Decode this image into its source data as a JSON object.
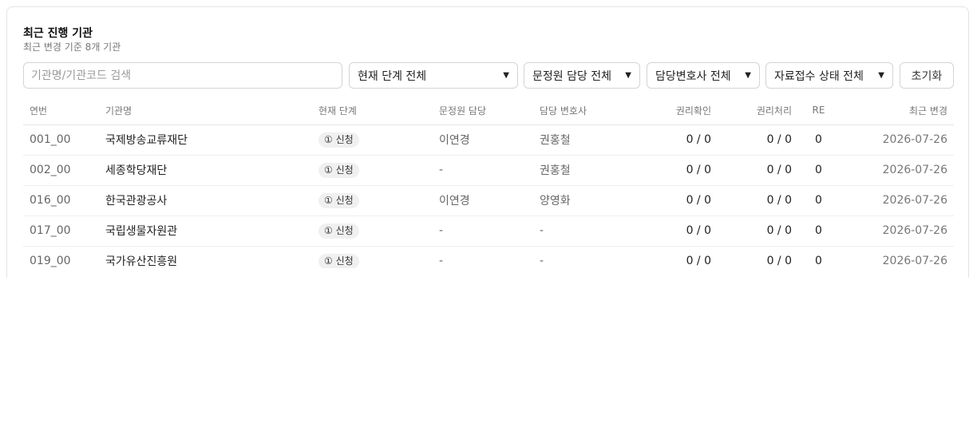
{
  "header": {
    "title": "최근 진행 기관",
    "subtitle": "최근 변경 기준 8개 기관"
  },
  "filters": {
    "search_placeholder": "기관명/기관코드 검색",
    "stage": "현재 단계 전체",
    "manager": "문정원 담당 전체",
    "lawyer": "담당변호사 전체",
    "intake": "자료접수 상태 전체",
    "reset_label": "초기화"
  },
  "table": {
    "headers": [
      "연번",
      "기관명",
      "현재 단계",
      "문정원 담당",
      "담당 변호사",
      "권리확인",
      "권리처리",
      "RE",
      "최근 변경"
    ],
    "rows": [
      {
        "no": "001_00",
        "name": "국제방송교류재단",
        "stage": "① 신청",
        "manager": "이연경",
        "lawyer": "권홍철",
        "confirm": "0 / 0",
        "process": "0 / 0",
        "re": "0",
        "date": "2026-07-26"
      },
      {
        "no": "002_00",
        "name": "세종학당재단",
        "stage": "① 신청",
        "manager": "-",
        "lawyer": "권홍철",
        "confirm": "0 / 0",
        "process": "0 / 0",
        "re": "0",
        "date": "2026-07-26"
      },
      {
        "no": "016_00",
        "name": "한국관광공사",
        "stage": "① 신청",
        "manager": "이연경",
        "lawyer": "양영화",
        "confirm": "0 / 0",
        "process": "0 / 0",
        "re": "0",
        "date": "2026-07-26"
      },
      {
        "no": "017_00",
        "name": "국립생물자원관",
        "stage": "① 신청",
        "manager": "-",
        "lawyer": "-",
        "confirm": "0 / 0",
        "process": "0 / 0",
        "re": "0",
        "date": "2026-07-26"
      },
      {
        "no": "019_00",
        "name": "국가유산진흥원",
        "stage": "① 신청",
        "manager": "-",
        "lawyer": "-",
        "confirm": "0 / 0",
        "process": "0 / 0",
        "re": "0",
        "date": "2026-07-26"
      }
    ]
  },
  "icons": {
    "select_chevron": "chevron-down-icon"
  }
}
